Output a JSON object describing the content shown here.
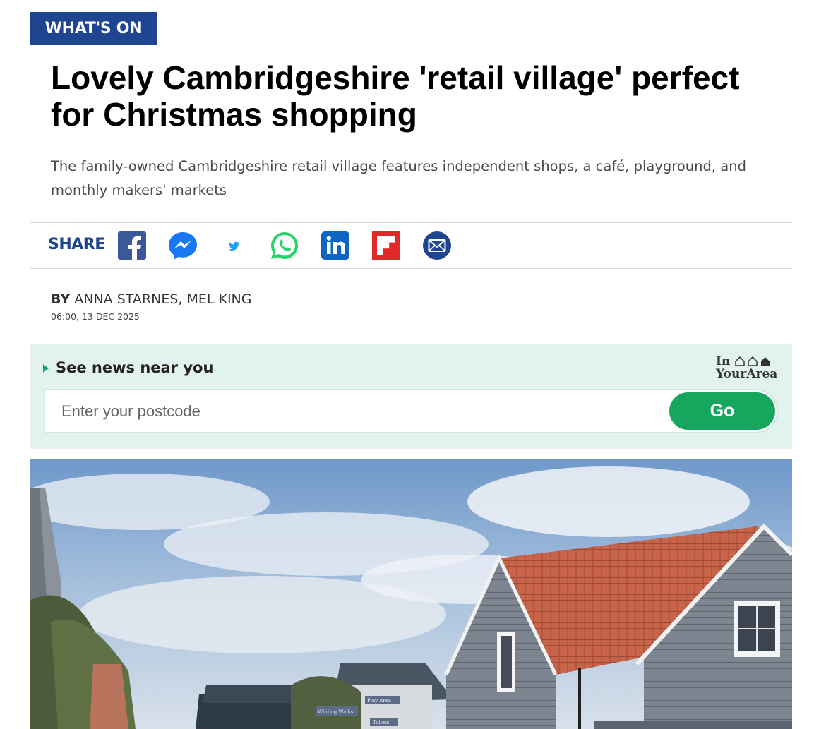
{
  "section_tag": "WHAT'S ON",
  "article": {
    "headline": "Lovely Cambridgeshire 'retail village' perfect for Christmas shopping",
    "standfirst": "The family-owned Cambridgeshire retail village features independent shops, a café, playground, and monthly makers' markets",
    "byline_prefix": "BY",
    "authors": "ANNA STARNES, MEL KING",
    "timestamp": "06:00, 13 DEC 2025"
  },
  "share": {
    "label": "SHARE",
    "icons": [
      "facebook-icon",
      "messenger-icon",
      "twitter-icon",
      "whatsapp-icon",
      "linkedin-icon",
      "flipboard-icon",
      "email-icon"
    ]
  },
  "news_near_you": {
    "title": "See news near you",
    "brand_line1": "In",
    "brand_line2": "YourArea",
    "postcode_placeholder": "Enter your postcode",
    "go_label": "Go"
  },
  "hero_image": {
    "signs": [
      "Wilding Walks",
      "Play Area",
      "Toilets"
    ]
  },
  "colors": {
    "brand_blue": "#1f4591",
    "accent_green": "#17a65e",
    "panel_green": "#e1f3ec",
    "facebook": "#3b5998",
    "whatsapp": "#25d366",
    "linkedin": "#0a66c2",
    "flipboard": "#e12828"
  }
}
